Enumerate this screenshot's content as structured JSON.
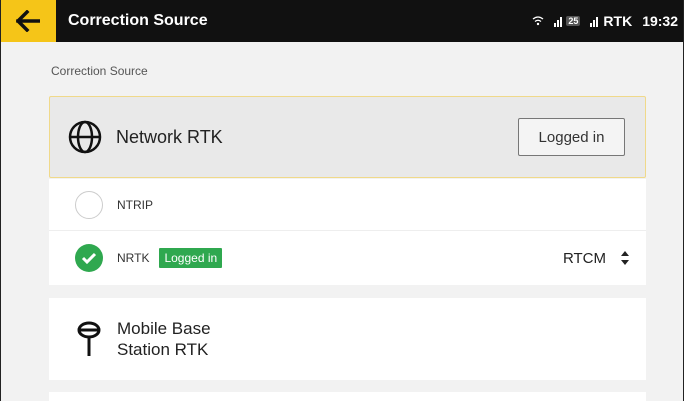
{
  "header": {
    "title": "Correction Source",
    "back_icon": "arrow-left-icon"
  },
  "status_bar": {
    "sim_badge": "25",
    "rtk_label": "RTK",
    "time": "19:32"
  },
  "section_label": "Correction Source",
  "network_rtk": {
    "title": "Network RTK",
    "icon": "globe-icon",
    "status_button": "Logged in"
  },
  "options": [
    {
      "label": "NTRIP",
      "selected": false
    },
    {
      "label": "NRTK",
      "selected": true,
      "badge": "Logged in",
      "format": "RTCM"
    }
  ],
  "mobile_base": {
    "title_line1": "Mobile Base",
    "title_line2": "Station RTK",
    "icon": "antenna-icon"
  },
  "colors": {
    "accent": "#f5c518",
    "success": "#2fa84f",
    "topbar": "#111111"
  }
}
